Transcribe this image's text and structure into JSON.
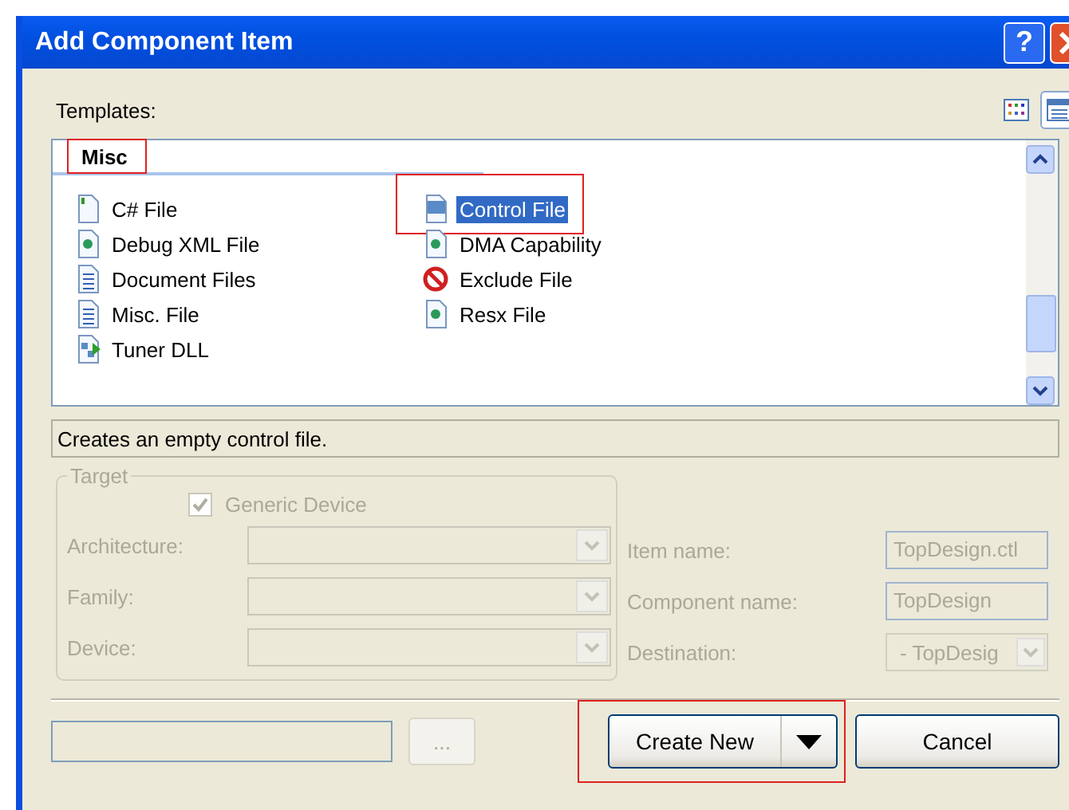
{
  "window": {
    "title": "Add Component Item",
    "help": "?"
  },
  "templates": {
    "label": "Templates:",
    "views": [
      {
        "kind": "icons",
        "selected": false
      },
      {
        "kind": "list",
        "selected": true
      }
    ]
  },
  "list": {
    "category": "Misc",
    "category_highlighted": true,
    "columns": [
      [
        {
          "label": "C# File",
          "kind": "cs",
          "selected": false,
          "highlighted": false
        },
        {
          "label": "Debug XML File",
          "kind": "xml",
          "selected": false,
          "highlighted": false
        },
        {
          "label": "Document Files",
          "kind": "doc",
          "selected": false,
          "highlighted": false
        },
        {
          "label": "Misc. File",
          "kind": "doc",
          "selected": false,
          "highlighted": false
        },
        {
          "label": "Tuner DLL",
          "kind": "dll",
          "selected": false,
          "highlighted": false
        }
      ],
      [
        {
          "label": "Control File",
          "kind": "ctl",
          "selected": true,
          "highlighted": true
        },
        {
          "label": "DMA Capability",
          "kind": "xml",
          "selected": false,
          "highlighted": false
        },
        {
          "label": "Exclude File",
          "kind": "exclude",
          "selected": false,
          "highlighted": false
        },
        {
          "label": "Resx File",
          "kind": "xml",
          "selected": false,
          "highlighted": false
        }
      ]
    ]
  },
  "description": "Creates an empty control file.",
  "target": {
    "legend": "Target",
    "disabled": true,
    "checkbox": {
      "label": "Generic Device",
      "checked": true
    },
    "dropdowns": [
      {
        "label": "Architecture:"
      },
      {
        "label": "Family:"
      },
      {
        "label": "Device:"
      }
    ]
  },
  "fields": [
    {
      "label": "Item name:",
      "value": "TopDesign.ctl",
      "kind": "text"
    },
    {
      "label": "Component name:",
      "value": "TopDesign",
      "kind": "text"
    },
    {
      "label": "Destination:",
      "value": "- TopDesig",
      "kind": "dropdown"
    }
  ],
  "browse_button": "...",
  "buttons": [
    {
      "label": "Create New",
      "kind": "split",
      "highlighted": true
    },
    {
      "label": "Cancel",
      "kind": "plain",
      "highlighted": false
    }
  ]
}
